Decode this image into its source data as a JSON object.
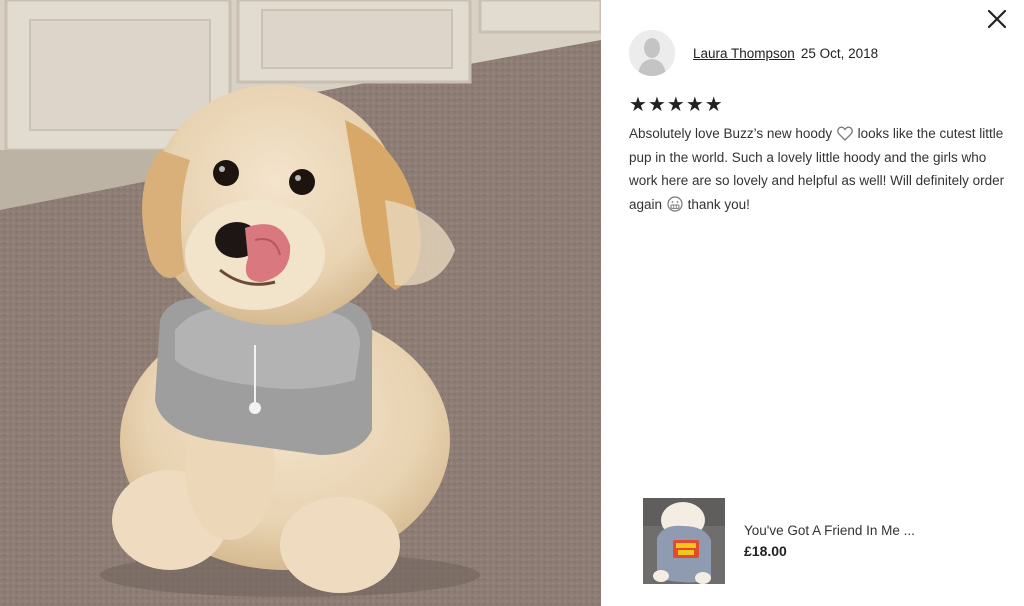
{
  "review": {
    "reviewer_name": "Laura Thompson",
    "date": "25 Oct, 2018",
    "rating": 5,
    "stars": [
      "★",
      "★",
      "★",
      "★",
      "★"
    ],
    "text_part1": "Absolutely love Buzz’s new hoody",
    "text_part2": "looks like the cutest little pup in the world. Such a lovely little hoody and the girls who work here are so lovely and helpful as well! Will definitely order again",
    "text_part3": "thank you!",
    "inline_icons": [
      "heart-icon",
      "grimace-emoji-icon"
    ]
  },
  "product": {
    "title": "You've Got A Friend In Me ...",
    "price": "£18.00"
  },
  "icons": {
    "close": "close-icon",
    "avatar": "avatar-placeholder-icon"
  },
  "colors": {
    "text": "#222222",
    "carpet": "#8a7a72",
    "cabinet": "#ddd5c8",
    "hoody": "#9c9c9c"
  }
}
